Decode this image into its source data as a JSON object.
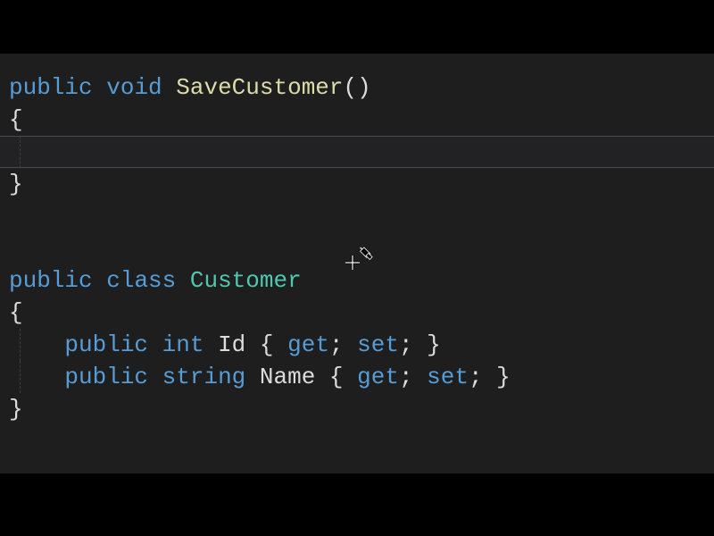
{
  "code": {
    "line1": {
      "kw_public": "public",
      "sp": " ",
      "kw_void": "void",
      "method": "SaveCustomer",
      "parens": "()"
    },
    "line2": {
      "brace": "{"
    },
    "line3": {
      "content": "    "
    },
    "line4": {
      "brace": "}"
    },
    "line5": {
      "content": ""
    },
    "line6": {
      "content": ""
    },
    "line7": {
      "kw_public": "public",
      "sp": " ",
      "kw_class": "class",
      "type": "Customer"
    },
    "line8": {
      "brace": "{"
    },
    "line9": {
      "indent": "    ",
      "kw_public": "public",
      "sp": " ",
      "kw_int": "int",
      "ident": "Id",
      "pre": " { ",
      "kw_get": "get",
      "semi1": "; ",
      "kw_set": "set",
      "post": "; }"
    },
    "line10": {
      "indent": "    ",
      "kw_public": "public",
      "sp": " ",
      "kw_string": "string",
      "ident": "Name",
      "pre": " { ",
      "kw_get": "get",
      "semi1": "; ",
      "kw_set": "set",
      "post": "; }"
    },
    "line11": {
      "brace": "}"
    }
  },
  "cursor": {
    "name": "eyedropper-cursor"
  }
}
